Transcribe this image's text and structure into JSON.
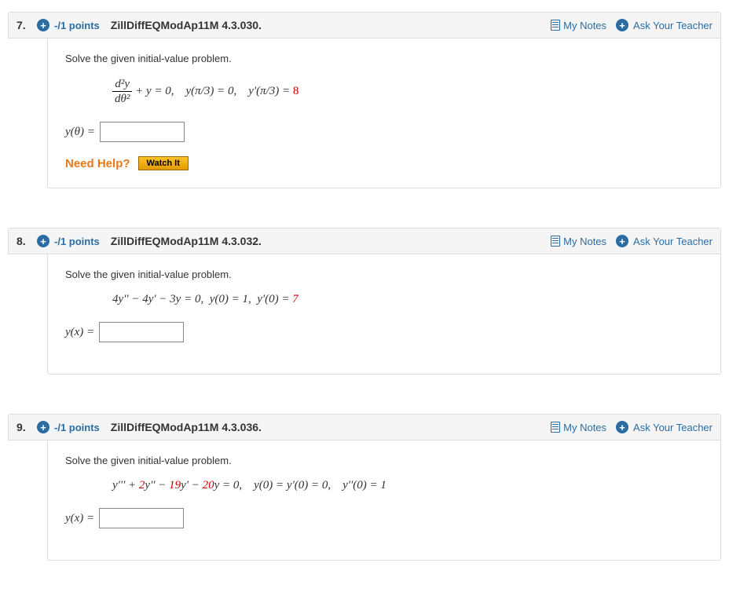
{
  "labels": {
    "my_notes": "My Notes",
    "ask_teacher": "Ask Your Teacher",
    "need_help": "Need Help?",
    "watch_it": "Watch It"
  },
  "questions": [
    {
      "number": "7.",
      "points": "-/1 points",
      "ref": "ZillDiffEQModAp11M 4.3.030.",
      "prompt": "Solve the given initial-value problem.",
      "equation": {
        "frac_num": "d²y",
        "frac_den": "dθ²",
        "rest_a": " + y = 0, y(π/3) = 0, y'(π/3) = ",
        "red": "8"
      },
      "answer_label": "y(θ) =",
      "show_help": true
    },
    {
      "number": "8.",
      "points": "-/1 points",
      "ref": "ZillDiffEQModAp11M 4.3.032.",
      "prompt": "Solve the given initial-value problem.",
      "equation_plain_a": "4y'' − 4y' − 3y = 0,  y(0) = 1,  y'(0) = ",
      "equation_plain_red": "7",
      "answer_label": "y(x) =",
      "show_help": false
    },
    {
      "number": "9.",
      "points": "-/1 points",
      "ref": "ZillDiffEQModAp11M 4.3.036.",
      "prompt": "Solve the given initial-value problem.",
      "equation_plain_a": "y''' + ",
      "equation_plain_red": "2",
      "equation_plain_b": "y'' − ",
      "equation_plain_red2": "19",
      "equation_plain_c": "y' − ",
      "equation_plain_red3": "20",
      "equation_plain_d": "y = 0, y(0) = y'(0) = 0, y''(0) = 1",
      "answer_label": "y(x) =",
      "show_help": false
    }
  ]
}
